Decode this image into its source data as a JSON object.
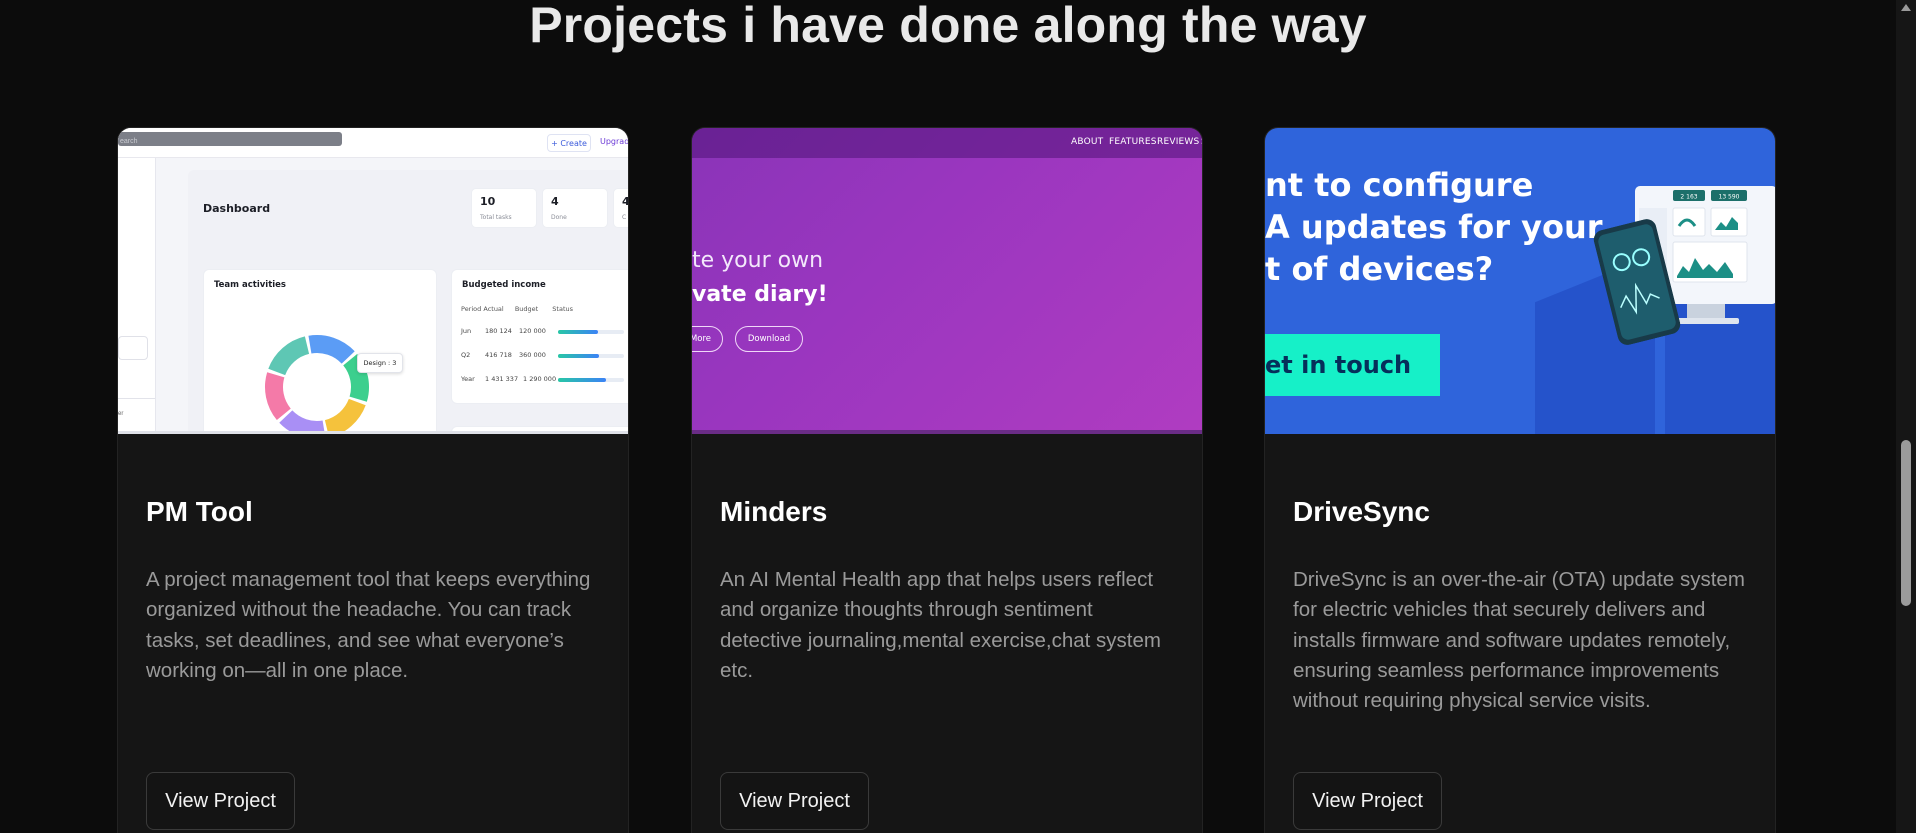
{
  "section": {
    "title": "Projects i have done along the way"
  },
  "projects": [
    {
      "name": "PM Tool",
      "description": "A project management tool that keeps everything organized without the headache. You can track tasks, set deadlines, and see what everyone’s working on—all in one place.",
      "button_label": "View Project",
      "preview": {
        "search_placeholder": "earch",
        "create_label": "+ Create",
        "upgrade_label": "Upgrade",
        "dashboard_title": "Dashboard",
        "stats": [
          {
            "value": "10",
            "label": "Total tasks"
          },
          {
            "value": "4",
            "label": "Done"
          },
          {
            "value": "4",
            "label": "C"
          }
        ],
        "team_activities_title": "Team activities",
        "tooltip": "Design : 3",
        "sidebar_text": "er",
        "budget_title": "Budgeted income",
        "budget_headers": [
          "Period",
          "Actual",
          "Budget",
          "Status"
        ],
        "budget_rows": [
          {
            "period": "Jun",
            "actual": "180 124",
            "budget": "120 000",
            "status": 0.6
          },
          {
            "period": "Q2",
            "actual": "416 718",
            "budget": "360 000",
            "status": 0.62
          },
          {
            "period": "Year",
            "actual": "1 431 337",
            "budget": "1 290 000",
            "status": 0.72
          }
        ],
        "donut_colors": [
          "#5b9cf5",
          "#3ccf8e",
          "#f5c23c",
          "#a98ff5",
          "#f47aa8",
          "#5ec7b4"
        ]
      }
    },
    {
      "name": "Minders",
      "description": "An AI Mental Health app that helps users reflect and organize thoughts through sentiment detective journaling,mental exercise,chat system etc.",
      "button_label": "View Project",
      "preview": {
        "nav_links": [
          "ABOUT",
          "FEATURES",
          "REVIEWS",
          "S"
        ],
        "headline_line1": "te your own",
        "headline_line2": "vate diary!",
        "more_label": "More",
        "download_label": "Download"
      }
    },
    {
      "name": "DriveSync",
      "description": "DriveSync is an over-the-air (OTA) update system for electric vehicles that securely delivers and installs firmware and software updates remotely, ensuring seamless performance improvements without requiring physical service visits.",
      "button_label": "View Project",
      "preview": {
        "headline_line1": "nt to configure",
        "headline_line2": "A updates for your",
        "headline_line3": "t of devices?",
        "cta_label": "et in touch",
        "screen_stats": [
          "2 163",
          "13 590"
        ]
      }
    }
  ],
  "colors": {
    "background": "#0c0c0c",
    "card": "#151515",
    "title": "#e9e9e9",
    "description": "#9a9a9a",
    "minders_purple": "#9a36bf",
    "drivesync_blue": "#2f64db",
    "drivesync_cta": "#16f0c8"
  }
}
